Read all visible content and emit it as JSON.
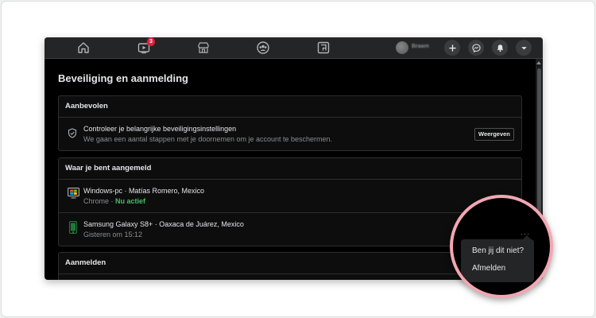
{
  "topbar": {
    "notification_count": "3",
    "profile_name": "Braam"
  },
  "page": {
    "title": "Beveiliging en aanmelding"
  },
  "recommended": {
    "header": "Aanbevolen",
    "item_title": "Controleer je belangrijke beveiligingsinstellingen",
    "item_desc": "We gaan een aantal stappen met je doornemen om je account te beschermen.",
    "button": "Weergeven"
  },
  "logged_in": {
    "header": "Waar je bent aangemeld",
    "sessions": [
      {
        "device": "Windows-pc · Matías Romero, Mexico",
        "browser": "Chrome · ",
        "status": "Nu actief"
      },
      {
        "device": "Samsung Galaxy S8+ · Oaxaca de Juárez, Mexico",
        "time": "Gisteren om 15:12"
      }
    ]
  },
  "login": {
    "header": "Aanmelden"
  },
  "popup": {
    "not_you": "Ben jij dit niet?",
    "logout": "Afmelden"
  },
  "colors": {
    "active_green": "#45bd62",
    "badge_red": "#e41e3f",
    "magnifier_border": "#f3a6b2"
  }
}
